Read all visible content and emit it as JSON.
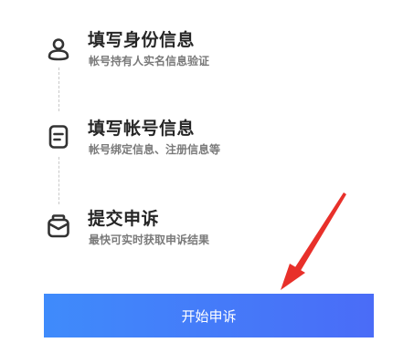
{
  "steps": [
    {
      "icon": "user-icon",
      "title": "填写身份信息",
      "desc": "帐号持有人实名信息验证"
    },
    {
      "icon": "document-icon",
      "title": "填写帐号信息",
      "desc": "帐号绑定信息、注册信息等"
    },
    {
      "icon": "envelope-icon",
      "title": "提交申诉",
      "desc": "最快可实时获取申诉结果"
    }
  ],
  "button": {
    "label": "开始申诉"
  },
  "colors": {
    "button_start": "#3f8bfb",
    "button_end": "#4a6cf7",
    "arrow": "#e8302a"
  }
}
